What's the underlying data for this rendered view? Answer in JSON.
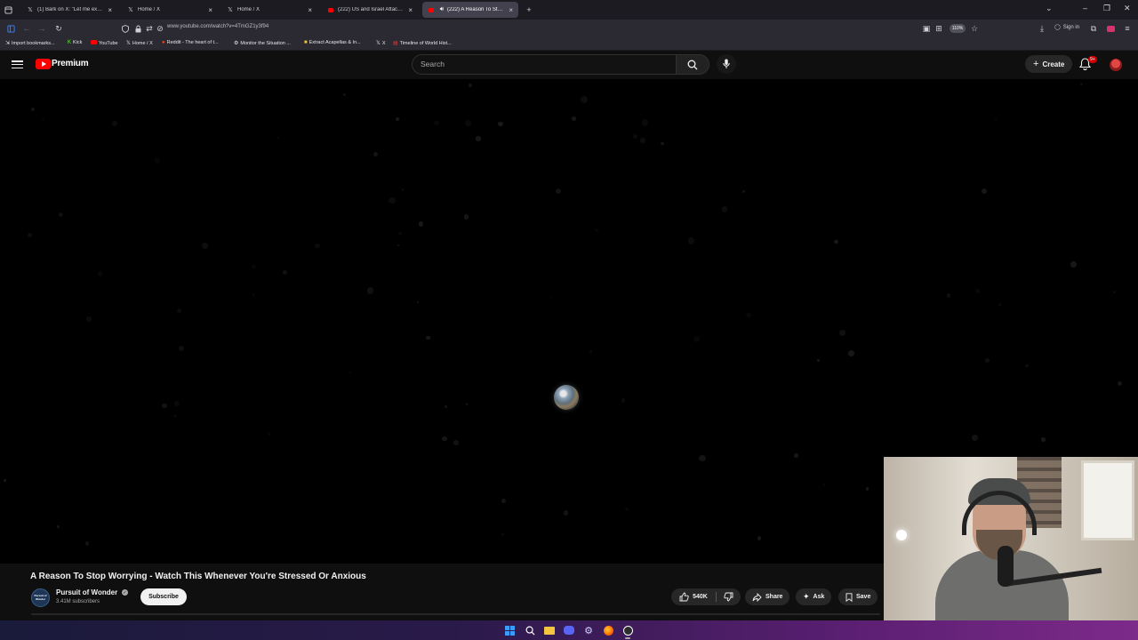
{
  "browser": {
    "tabs": [
      {
        "title": "(1) Bark on X: \"Let me explain v",
        "icon": "x-logo-icon",
        "active": false
      },
      {
        "title": "Home / X",
        "icon": "x-logo-icon",
        "active": false
      },
      {
        "title": "Home / X",
        "icon": "x-logo-icon",
        "active": false
      },
      {
        "title": "(222) US and Israel Attack Iran",
        "icon": "youtube-icon",
        "active": false
      },
      {
        "title": "(222) A Reason To Stop Wo",
        "icon": "youtube-icon",
        "active": true
      }
    ],
    "url": "www.youtube.com/watch?v=4TmGZ1y3f94",
    "zoom": "110%",
    "signin_label": "Sign in",
    "bookmarks": [
      {
        "label": "Import bookmarks...",
        "icon": "import-icon"
      },
      {
        "label": "Kick",
        "icon": "kick-icon"
      },
      {
        "label": "YouTube",
        "icon": "youtube-icon"
      },
      {
        "label": "Home / X",
        "icon": "x-logo-icon"
      },
      {
        "label": "Reddit - The heart of t...",
        "icon": "reddit-icon"
      },
      {
        "label": "Monitor the Situation ...",
        "icon": "monitor-icon"
      },
      {
        "label": "Extract Acapellas & In...",
        "icon": "music-icon"
      },
      {
        "label": "X",
        "icon": "x-logo-icon"
      },
      {
        "label": "Timeline of World Hist...",
        "icon": "flag-icon"
      }
    ]
  },
  "youtube": {
    "logo_text": "Premium",
    "search_placeholder": "Search",
    "create_label": "Create",
    "notification_count": "9+",
    "accent_color": "#ff0000"
  },
  "video": {
    "title": "A Reason To Stop Worrying - Watch This Whenever You're Stressed Or Anxious",
    "channel": {
      "name": "Pursuit of Wonder",
      "avatar_text": "Pursuit of Wonder",
      "subscribers": "3.41M subscribers"
    },
    "subscribe_label": "Subscribe",
    "likes": "540K",
    "share_label": "Share",
    "ask_label": "Ask",
    "save_label": "Save"
  }
}
